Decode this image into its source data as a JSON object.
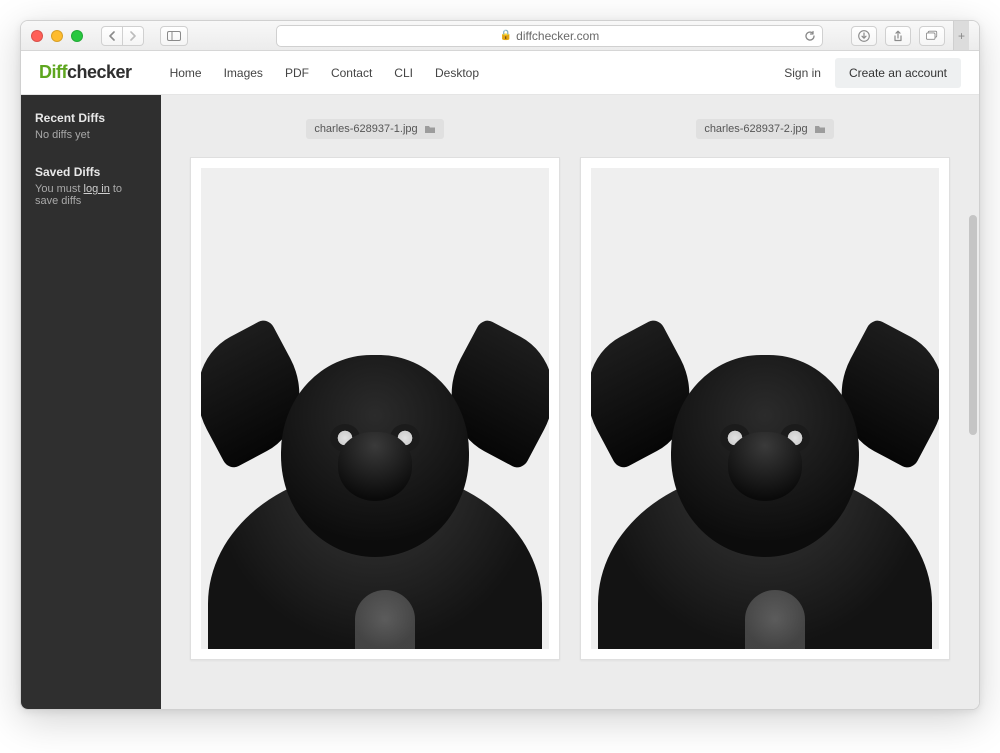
{
  "browser": {
    "address": "diffchecker.com"
  },
  "logo": {
    "part1": "Diff",
    "part2": "checker"
  },
  "nav": {
    "home": "Home",
    "images": "Images",
    "pdf": "PDF",
    "contact": "Contact",
    "cli": "CLI",
    "desktop": "Desktop"
  },
  "auth": {
    "signin": "Sign in",
    "create_account": "Create an account"
  },
  "sidebar": {
    "recent_title": "Recent Diffs",
    "recent_empty": "No diffs yet",
    "saved_title": "Saved Diffs",
    "saved_prefix": "You must ",
    "saved_link": "log in",
    "saved_suffix": " to save diffs"
  },
  "images": {
    "left_filename": "charles-628937-1.jpg",
    "right_filename": "charles-628937-2.jpg"
  }
}
